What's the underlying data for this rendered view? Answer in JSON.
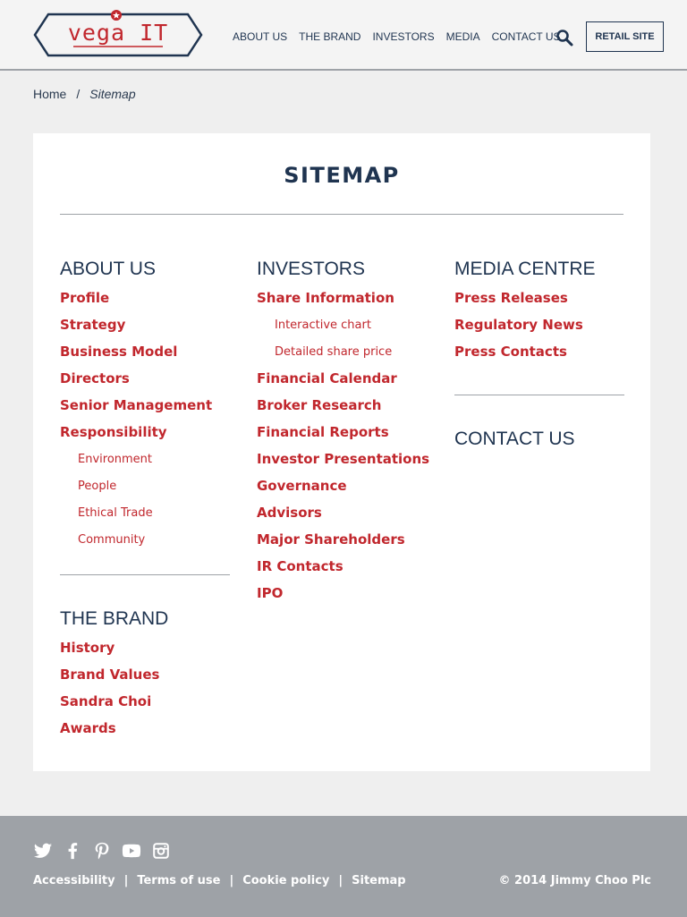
{
  "header": {
    "logo_text": "vega IT",
    "nav": [
      "ABOUT US",
      "THE BRAND",
      "INVESTORS",
      "MEDIA",
      "CONTACT US"
    ],
    "retail_button": "RETAIL SITE",
    "search_icon": "search-icon"
  },
  "breadcrumb": {
    "home": "Home",
    "separator": "/",
    "current": "Sitemap"
  },
  "sitemap": {
    "title": "SITEMAP",
    "about": {
      "heading": "ABOUT US",
      "links": [
        "Profile",
        "Strategy",
        "Business Model",
        "Directors",
        "Senior Management",
        "Responsibility"
      ],
      "sublinks": [
        "Environment",
        "People",
        "Ethical Trade",
        "Community"
      ]
    },
    "brand": {
      "heading": "THE BRAND",
      "links": [
        "History",
        "Brand Values",
        "Sandra Choi",
        "Awards"
      ]
    },
    "investors": {
      "heading": "INVESTORS",
      "first_link": "Share Information",
      "sublinks": [
        "Interactive chart",
        "Detailed share price"
      ],
      "links": [
        "Financial Calendar",
        "Broker Research",
        "Financial Reports",
        "Investor Presentations",
        "Governance",
        "Advisors",
        "Major Shareholders",
        "IR Contacts",
        "IPO"
      ]
    },
    "media": {
      "heading": "MEDIA CENTRE",
      "links": [
        "Press Releases",
        "Regulatory News",
        "Press Contacts"
      ]
    },
    "contact": {
      "heading": "CONTACT US"
    }
  },
  "footer": {
    "social_icons": [
      "twitter-icon",
      "facebook-icon",
      "pinterest-icon",
      "youtube-icon",
      "instagram-icon"
    ],
    "links": [
      "Accessibility",
      "Terms of use",
      "Cookie policy",
      "Sitemap"
    ],
    "separator": "|",
    "copyright": "© 2014 Jimmy Choo Plc"
  },
  "colors": {
    "accent": "#c1272d",
    "navy": "#1f3450",
    "footer": "#9ea2a7",
    "background": "#efefef"
  }
}
